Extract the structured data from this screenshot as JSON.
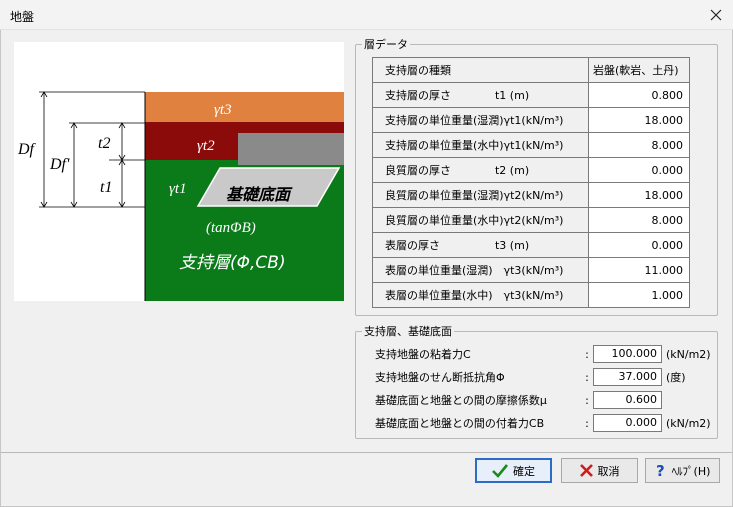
{
  "window": {
    "title": "地盤"
  },
  "diagram": {
    "labels": {
      "gt3": "γt3",
      "gt2": "γt2",
      "gt1": "γt1",
      "base": "基礎底面",
      "tan": "(tanΦB)",
      "layer": "支持層(Φ,CB)",
      "df": "Df",
      "dfp": "Df'",
      "t2": "t2",
      "t1": "t1"
    },
    "colors": {
      "layer3": "#e0813f",
      "layer2": "#8b0a0a",
      "layer1": "#0b7b1a",
      "foundation": "#8a8a8a"
    }
  },
  "layer_group": {
    "legend": "層データ",
    "header": {
      "label": "支持層の種類",
      "value": "岩盤(軟岩、土丹)"
    },
    "rows": [
      {
        "label": "支持層の厚さ　　　　t1 (m)",
        "value": "0.800"
      },
      {
        "label": "支持層の単位重量(湿潤)γt1(kN/m³)",
        "value": "18.000"
      },
      {
        "label": "支持層の単位重量(水中)γt1(kN/m³)",
        "value": "8.000"
      },
      {
        "label": "良質層の厚さ　　　　t2 (m)",
        "value": "0.000"
      },
      {
        "label": "良質層の単位重量(湿潤)γt2(kN/m³)",
        "value": "18.000"
      },
      {
        "label": "良質層の単位重量(水中)γt2(kN/m³)",
        "value": "8.000"
      },
      {
        "label": "表層の厚さ　　　　　t3 (m)",
        "value": "0.000"
      },
      {
        "label": "表層の単位重量(湿潤)　γt3(kN/m³)",
        "value": "11.000"
      },
      {
        "label": "表層の単位重量(水中)　γt3(kN/m³)",
        "value": "1.000"
      }
    ]
  },
  "base_group": {
    "legend": "支持層、基礎底面",
    "fields": [
      {
        "label": "支持地盤の粘着力C",
        "value": "100.000",
        "unit": "(kN/m2)"
      },
      {
        "label": "支持地盤のせん断抵抗角Φ",
        "value": "37.000",
        "unit": "(度)"
      },
      {
        "label": "基礎底面と地盤との間の摩擦係数μ",
        "value": "0.600",
        "unit": ""
      },
      {
        "label": "基礎底面と地盤との間の付着力CB",
        "value": "0.000",
        "unit": "(kN/m2)"
      }
    ],
    "colon": ":"
  },
  "buttons": {
    "ok": "確定",
    "cancel": "取消",
    "help": "ﾍﾙﾌﾟ(H)"
  }
}
